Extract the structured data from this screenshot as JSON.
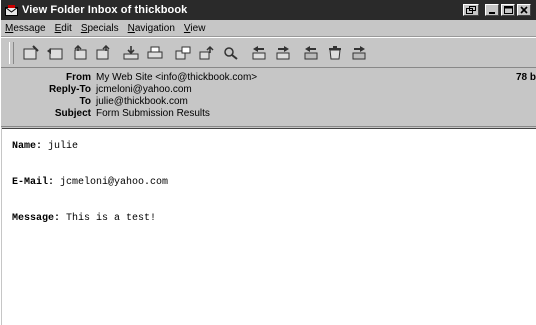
{
  "window": {
    "title": "View Folder Inbox of thickbook",
    "controls": [
      "restore",
      "minimize",
      "maximize",
      "close"
    ]
  },
  "menubar": {
    "items": [
      {
        "label": "Message",
        "accel": "M"
      },
      {
        "label": "Edit",
        "accel": "E"
      },
      {
        "label": "Specials",
        "accel": "S"
      },
      {
        "label": "Navigation",
        "accel": "N"
      },
      {
        "label": "View",
        "accel": "V"
      }
    ]
  },
  "toolbar": {
    "buttons": [
      "new-message-icon",
      "reply-icon",
      "reply-all-icon",
      "forward-icon",
      "download-icon",
      "print-icon",
      "move-icon",
      "copy-icon",
      "search-icon",
      "prev-icon",
      "next-icon",
      "prev-unread-icon",
      "delete-icon",
      "next-unread-icon"
    ]
  },
  "headers": {
    "from_label": "From",
    "from_value": "My Web Site <info@thickbook.com>",
    "replyto_label": "Reply-To",
    "replyto_value": "jcmeloni@yahoo.com",
    "to_label": "To",
    "to_value": "julie@thickbook.com",
    "subject_label": "Subject",
    "subject_value": "Form Submission Results",
    "size": "78 b"
  },
  "body": {
    "name_label": "Name:",
    "name_value": " julie",
    "email_label": "E-Mail:",
    "email_value": " jcmeloni@yahoo.com",
    "message_label": "Message:",
    "message_value": " This is a test!"
  }
}
